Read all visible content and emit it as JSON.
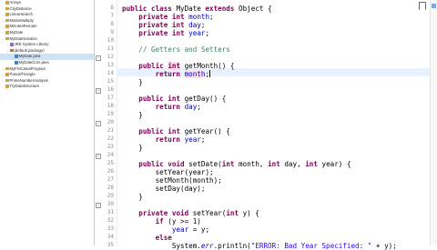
{
  "explorer": {
    "items": [
      {
        "label": "Arrays",
        "type": "project"
      },
      {
        "label": "CityDistance",
        "type": "project"
      },
      {
        "label": "LinearSearch",
        "type": "project"
      },
      {
        "label": "MatrixMultiply",
        "type": "project"
      },
      {
        "label": "MinutesRemain",
        "type": "project"
      },
      {
        "label": "MyDate",
        "type": "project"
      },
      {
        "label": "MyDateSolution",
        "type": "project"
      },
      {
        "label": "JRE System Library",
        "type": "lib"
      },
      {
        "label": "(default package)",
        "type": "pkg"
      },
      {
        "label": "MyDate.java",
        "type": "java",
        "selected": true
      },
      {
        "label": "MyDateCore.java",
        "type": "java"
      },
      {
        "label": "MyFirstJavaProgram",
        "type": "project"
      },
      {
        "label": "PascalTriangle",
        "type": "project"
      },
      {
        "label": "PrimeNumberAnalysis",
        "type": "project"
      },
      {
        "label": "TryDataStructure",
        "type": "project"
      }
    ]
  },
  "editor": {
    "line_numbers": [
      "6",
      "7",
      "8",
      "9",
      "10",
      "11",
      "12",
      "13",
      "14",
      "15",
      "16",
      "17",
      "18",
      "19",
      "20",
      "21",
      "22",
      "23",
      "24",
      "25",
      "26",
      "27",
      "28",
      "29",
      "30",
      "31",
      "32",
      "33",
      "34",
      "35"
    ],
    "code": {
      "l6_kw1": "public class ",
      "l6_name": "MyDate ",
      "l6_kw2": "extends",
      "l6_rest": " Object {",
      "l7_kw": "private int ",
      "l7_fld": "month",
      "l8_kw": "private int ",
      "l8_fld": "day",
      "l9_kw": "private int ",
      "l9_fld": "year",
      "l11_cmt": "// Getters and Setters",
      "l12_kw": "public ",
      "l12_type": "int",
      "l12_rest": " getMonth() {",
      "l13_kw": "return ",
      "l13_fld": "month",
      "l14": "}",
      "l16_kw": "public int ",
      "l16_rest": "getDay() {",
      "l17_kw": "return ",
      "l17_fld": "day",
      "l18": "}",
      "l20_kw": "public int ",
      "l20_rest": "getYear() {",
      "l21_kw": "return ",
      "l21_fld": "year",
      "l22": "}",
      "l24_kw": "public void ",
      "l24_name": "setDate(",
      "l24_kw2": "int ",
      "l24_p1": "month, ",
      "l24_kw3": "int ",
      "l24_p2": "day, ",
      "l24_kw4": "int ",
      "l24_p3": "year) {",
      "l25": "setYear(year);",
      "l26": "setMonth(month);",
      "l27": "setDay(day);",
      "l28": "}",
      "l30_kw": "private void ",
      "l30_name": "setYear(",
      "l30_kw2": "int ",
      "l30_rest": "y) {",
      "l31_kw": "if ",
      "l31_rest": "(y >= 1)",
      "l32_fld": "year",
      "l32_rest": " = y;",
      "l33_kw": "else",
      "l34_sys": "System.",
      "l34_err": "err",
      "l34_print": ".println(",
      "l34_str": "\"ERROR: Bad Year Specified: \"",
      "l34_rest": " + y);"
    }
  }
}
